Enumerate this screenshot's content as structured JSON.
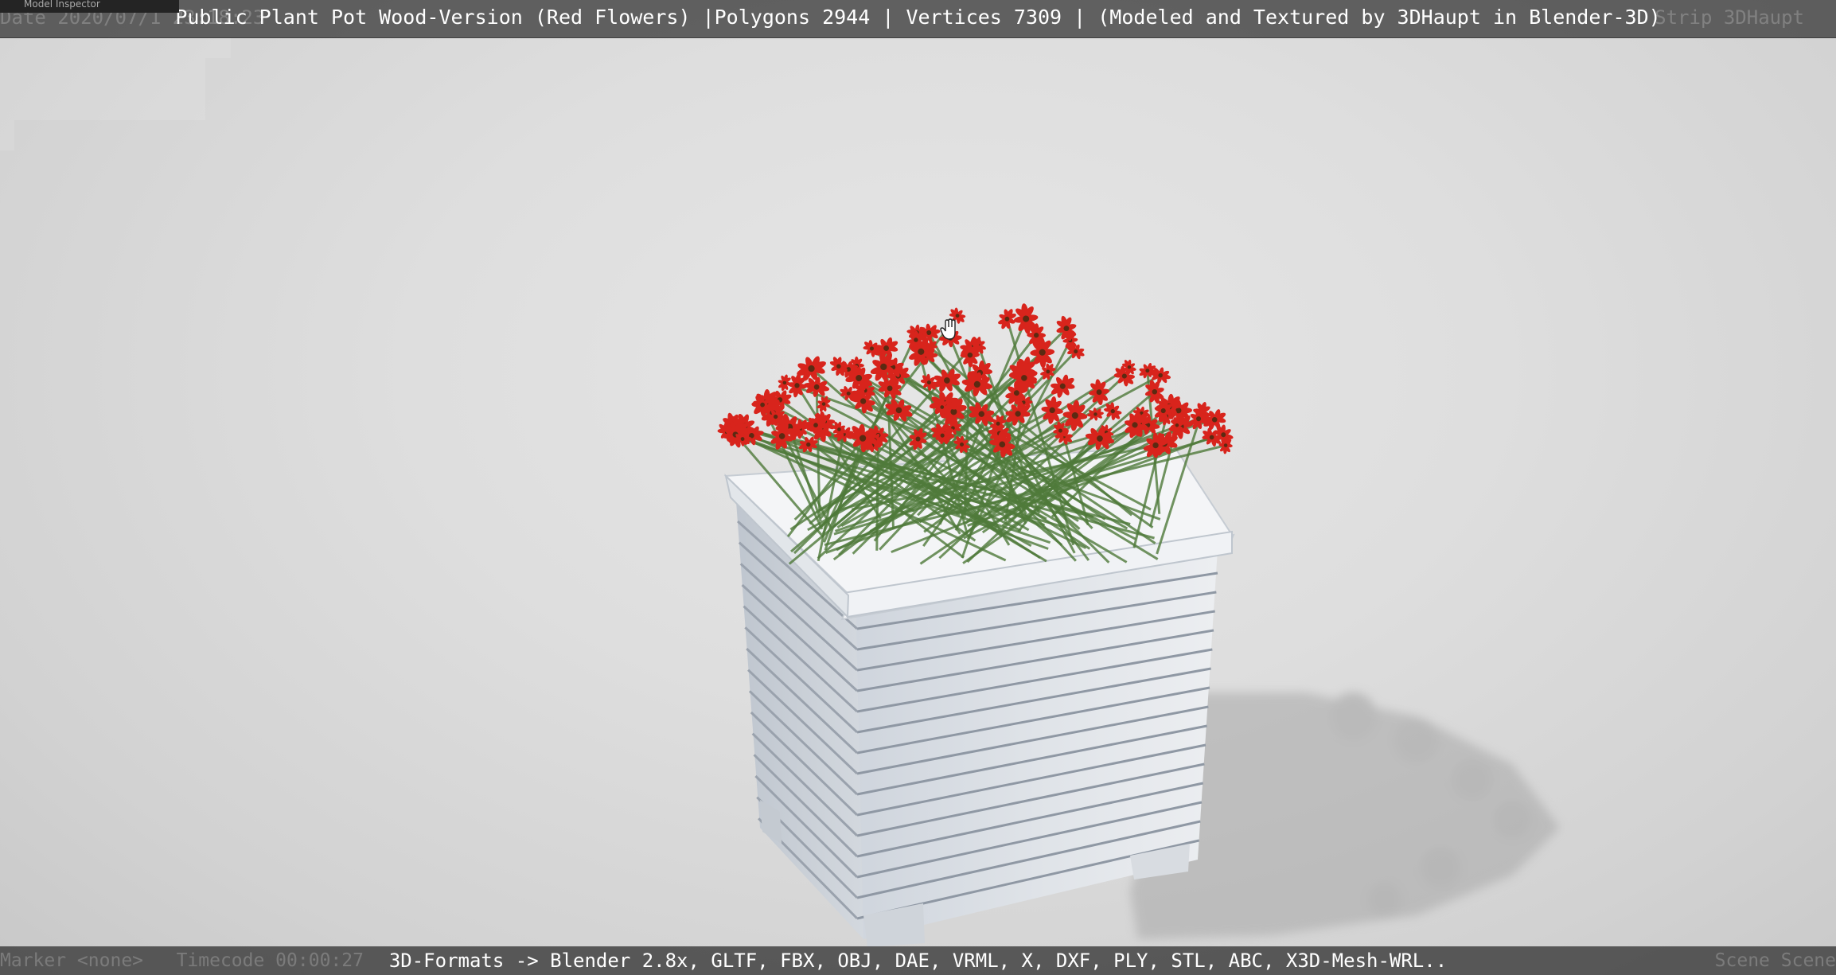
{
  "viewport": {
    "title": "Public Plant Pot Wood-Version (Red Flowers) |Polygons 2944 | Vertices 7309 | (Modeled and Textured by 3DHaupt in Blender-3D)",
    "formats": "3D-Formats -> Blender 2.8x, GLTF, FBX, OBJ, DAE, VRML, X, DXF, PLY, STL, ABC, X3D-Mesh-WRL..",
    "panel_tab": "Model Inspector",
    "overlay_date": "Date 2020/07/1  23:18:23",
    "overlay_strip": "Strip 3DHaupt",
    "overlay_marker": "Marker <none>",
    "overlay_timecode": "Timecode 00:00:27",
    "overlay_scene": "Scene Scene"
  },
  "scene": {
    "background_color": "#dcdcdc",
    "pot_color": "#e9ecef",
    "flower_color": "#d8241c",
    "stem_color": "#4f7a3a",
    "cursor_icon": "hand-cursor-icon"
  }
}
